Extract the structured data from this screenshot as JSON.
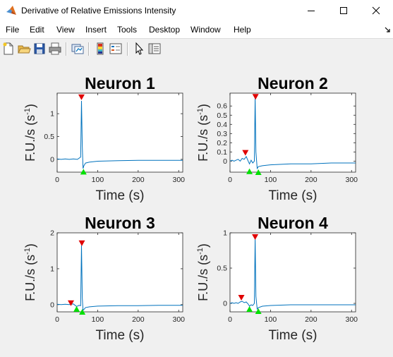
{
  "window": {
    "title": "Derivative of Relative Emissions Intensity"
  },
  "menu": {
    "items": [
      "File",
      "Edit",
      "View",
      "Insert",
      "Tools",
      "Desktop",
      "Window",
      "Help"
    ]
  },
  "toolbar": {
    "icons": [
      "new-figure-icon",
      "open-file-icon",
      "save-icon",
      "print-icon",
      "link-plot-icon",
      "insert-colorbar-icon",
      "insert-legend-icon",
      "edit-plot-arrow-icon",
      "property-inspector-icon"
    ]
  },
  "colors": {
    "line": "#0072bd",
    "peak_marker": "#e00000",
    "trough_marker": "#00e000"
  },
  "chart_data": [
    {
      "type": "line",
      "title": "Neuron 1",
      "xlabel": "Time (s)",
      "ylabel": "F.U./s (s",
      "ylabel_sup": "-1",
      "ylabel_close": ")",
      "xlim": [
        0,
        310
      ],
      "ylim": [
        -0.28,
        1.45
      ],
      "xticks": [
        0,
        100,
        200,
        300
      ],
      "yticks": [
        0,
        0.5,
        1
      ],
      "yticklabels": [
        "0",
        "0.5",
        "1"
      ],
      "series": [
        {
          "x": [
            0,
            10,
            20,
            30,
            40,
            50,
            58,
            60,
            62,
            64,
            66,
            70,
            80,
            100,
            150,
            200,
            250,
            300,
            310
          ],
          "y": [
            0.01,
            0.0,
            0.01,
            0.0,
            0.01,
            0.0,
            0.05,
            1.28,
            0.3,
            -0.2,
            -0.14,
            -0.08,
            -0.06,
            -0.04,
            -0.03,
            -0.02,
            -0.02,
            -0.02,
            -0.02
          ]
        }
      ],
      "peaks": [
        {
          "x": 60,
          "y": 1.36
        }
      ],
      "troughs": [
        {
          "x": 65,
          "y": -0.27
        }
      ]
    },
    {
      "type": "line",
      "title": "Neuron 2",
      "xlabel": "Time (s)",
      "ylabel": "F.U./s (s",
      "ylabel_sup": "-1",
      "ylabel_close": ")",
      "xlim": [
        0,
        310
      ],
      "ylim": [
        -0.12,
        0.74
      ],
      "xticks": [
        0,
        100,
        200,
        300
      ],
      "yticks": [
        0,
        0.1,
        0.2,
        0.3,
        0.4,
        0.5,
        0.6
      ],
      "yticklabels": [
        "0",
        "0.1",
        "0.2",
        "0.3",
        "0.4",
        "0.5",
        "0.6"
      ],
      "series": [
        {
          "x": [
            0,
            5,
            10,
            15,
            20,
            25,
            30,
            35,
            40,
            45,
            48,
            52,
            56,
            60,
            62,
            64,
            67,
            70,
            80,
            100,
            150,
            200,
            250,
            300,
            310
          ],
          "y": [
            0.0,
            0.01,
            0.0,
            0.01,
            0.02,
            0.0,
            0.03,
            0.02,
            0.05,
            0.0,
            -0.03,
            0.01,
            -0.02,
            0.0,
            0.69,
            0.1,
            -0.08,
            -0.06,
            -0.05,
            -0.04,
            -0.03,
            -0.03,
            -0.02,
            -0.02,
            -0.02
          ]
        }
      ],
      "peaks": [
        {
          "x": 38,
          "y": 0.09
        },
        {
          "x": 63,
          "y": 0.7
        }
      ],
      "troughs": [
        {
          "x": 48,
          "y": -0.11
        },
        {
          "x": 70,
          "y": -0.12
        }
      ]
    },
    {
      "type": "line",
      "title": "Neuron 3",
      "xlabel": "Time (s)",
      "ylabel": "F.U./s (s",
      "ylabel_sup": "-1",
      "ylabel_close": ")",
      "xlim": [
        0,
        310
      ],
      "ylim": [
        -0.2,
        2.0
      ],
      "xticks": [
        0,
        100,
        200,
        300
      ],
      "yticks": [
        0,
        1,
        2
      ],
      "yticklabels": [
        "0",
        "1",
        "2"
      ],
      "series": [
        {
          "x": [
            0,
            10,
            20,
            30,
            40,
            48,
            54,
            58,
            60,
            62,
            64,
            70,
            80,
            100,
            150,
            200,
            250,
            300,
            310
          ],
          "y": [
            0.01,
            0.0,
            0.01,
            0.0,
            0.02,
            -0.05,
            -0.02,
            -0.03,
            1.65,
            0.2,
            -0.16,
            -0.08,
            -0.06,
            -0.04,
            -0.03,
            -0.03,
            -0.02,
            -0.02,
            -0.02
          ]
        }
      ],
      "peaks": [
        {
          "x": 34,
          "y": 0.04
        },
        {
          "x": 61,
          "y": 1.71
        }
      ],
      "troughs": [
        {
          "x": 48,
          "y": -0.12
        },
        {
          "x": 62,
          "y": -0.2
        }
      ]
    },
    {
      "type": "line",
      "title": "Neuron 4",
      "xlabel": "Time (s)",
      "ylabel": "F.U./s (s",
      "ylabel_sup": "-1",
      "ylabel_close": ")",
      "xlim": [
        0,
        310
      ],
      "ylim": [
        -0.12,
        1.0
      ],
      "xticks": [
        0,
        100,
        200,
        300
      ],
      "yticks": [
        0,
        0.5,
        1
      ],
      "yticklabels": [
        "0",
        "0.5",
        "1"
      ],
      "series": [
        {
          "x": [
            0,
            5,
            10,
            15,
            20,
            25,
            30,
            35,
            40,
            45,
            48,
            52,
            56,
            60,
            62,
            64,
            67,
            70,
            80,
            100,
            150,
            200,
            250,
            300,
            310
          ],
          "y": [
            0.0,
            0.01,
            0.0,
            0.01,
            0.0,
            0.02,
            0.03,
            0.01,
            0.02,
            -0.01,
            -0.04,
            -0.02,
            -0.03,
            0.0,
            0.92,
            0.1,
            -0.08,
            -0.06,
            -0.04,
            -0.03,
            -0.02,
            -0.02,
            -0.02,
            -0.02,
            -0.02
          ]
        }
      ],
      "peaks": [
        {
          "x": 28,
          "y": 0.08
        },
        {
          "x": 62,
          "y": 0.94
        }
      ],
      "troughs": [
        {
          "x": 48,
          "y": -0.08
        },
        {
          "x": 70,
          "y": -0.11
        }
      ]
    }
  ]
}
